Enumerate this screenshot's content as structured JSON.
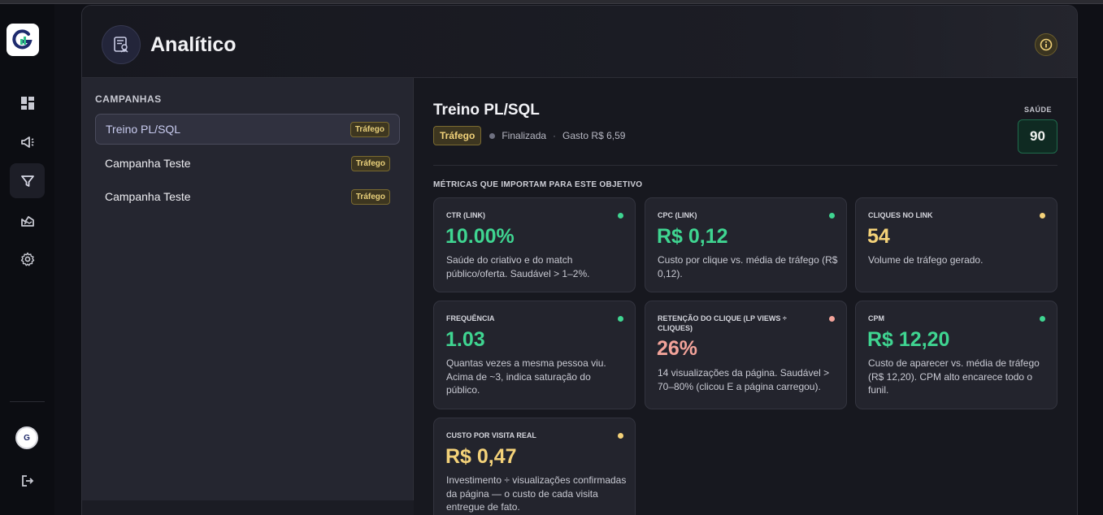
{
  "sidebar": {
    "logo_icon": "brand-g-logo",
    "nav": [
      {
        "icon": "dashboard-icon",
        "active": false
      },
      {
        "icon": "megaphone-icon",
        "active": false
      },
      {
        "icon": "funnel-icon",
        "active": true
      },
      {
        "icon": "chart-area-icon",
        "active": false
      },
      {
        "icon": "gear-icon",
        "active": false
      }
    ],
    "avatar_text": "G",
    "logout_icon": "logout-icon"
  },
  "header": {
    "title": "Analítico",
    "icon": "analytics-report-icon",
    "info_icon": "info-icon"
  },
  "campaigns": {
    "heading": "CAMPANHAS",
    "items": [
      {
        "name": "Treino PL/SQL",
        "tag": "Tráfego",
        "selected": true
      },
      {
        "name": "Campanha Teste",
        "tag": "Tráfego",
        "selected": false
      },
      {
        "name": "Campanha Teste",
        "tag": "Tráfego",
        "selected": false
      }
    ]
  },
  "detail": {
    "title": "Treino PL/SQL",
    "tag": "Tráfego",
    "status": "Finalizada",
    "separator": "·",
    "spend": "Gasto R$ 6,59",
    "health_label": "SAÚDE",
    "health_value": "90",
    "metrics_heading": "MÉTRICAS QUE IMPORTAM PARA ESTE OBJETIVO",
    "metrics": [
      {
        "label": "CTR (LINK)",
        "value": "10.00%",
        "status": "green",
        "desc": "Saúde do criativo e do match público/oferta. Saudável > 1–2%."
      },
      {
        "label": "CPC (LINK)",
        "value": "R$ 0,12",
        "status": "green",
        "desc": "Custo por clique vs. média de tráfego (R$ 0,12)."
      },
      {
        "label": "CLIQUES NO LINK",
        "value": "54",
        "status": "yellow",
        "desc": "Volume de tráfego gerado."
      },
      {
        "label": "FREQUÊNCIA",
        "value": "1.03",
        "status": "green",
        "desc": "Quantas vezes a mesma pessoa viu. Acima de ~3, indica saturação do público."
      },
      {
        "label": "RETENÇÃO DO CLIQUE (LP VIEWS ÷ CLIQUES)",
        "value": "26%",
        "status": "pink",
        "desc": "14 visualizações da página. Saudável > 70–80% (clicou E a página carregou)."
      },
      {
        "label": "CPM",
        "value": "R$ 12,20",
        "status": "green",
        "desc": "Custo de aparecer vs. média de tráfego (R$ 12,20). CPM alto encarece todo o funil."
      },
      {
        "label": "CUSTO POR VISITA REAL",
        "value": "R$ 0,47",
        "status": "yellow",
        "desc": "Investimento ÷ visualizações confirmadas da página — o custo de cada visita entregue de fato."
      }
    ]
  }
}
